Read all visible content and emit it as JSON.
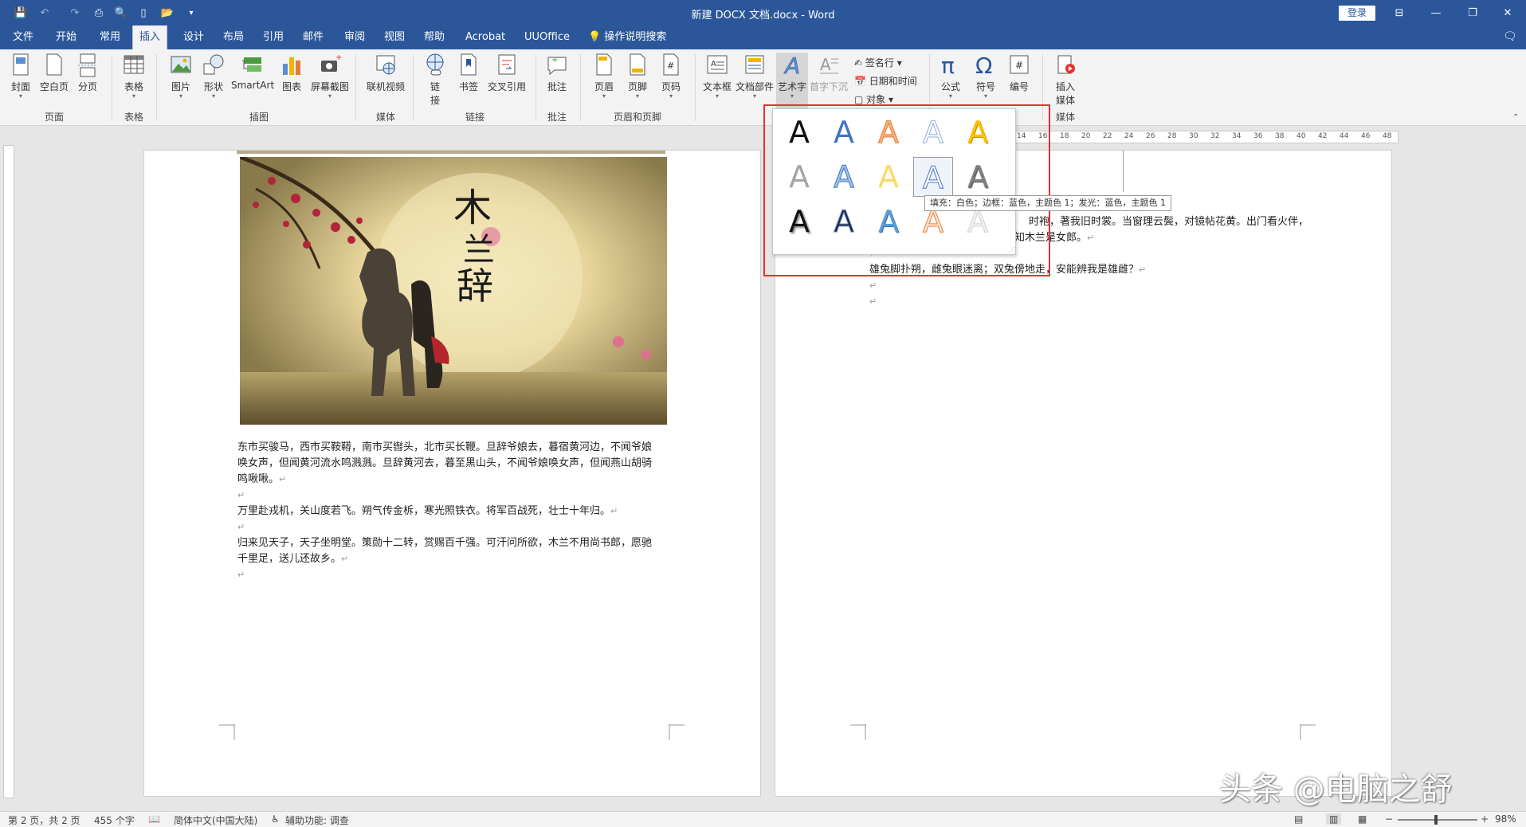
{
  "window": {
    "title": "新建 DOCX 文档.docx  -  Word",
    "login": "登录"
  },
  "tabs": [
    "文件",
    "开始",
    "常用",
    "插入",
    "设计",
    "布局",
    "引用",
    "邮件",
    "审阅",
    "视图",
    "帮助",
    "Acrobat",
    "UUOffice"
  ],
  "active_tab": "插入",
  "tell_me": "操作说明搜索",
  "ribbon": {
    "buttons": {
      "cover": "封面",
      "blank": "空白页",
      "pagebreak": "分页",
      "table": "表格",
      "picture": "图片",
      "shapes": "形状",
      "smartart": "SmartArt",
      "chart": "图表",
      "screenshot": "屏幕截图",
      "online_video": "联机视频",
      "link_1": "链",
      "link_2": "接",
      "bookmark": "书签",
      "crossref": "交叉引用",
      "comment": "批注",
      "header": "页眉",
      "footer": "页脚",
      "pagenum": "页码",
      "textbox": "文本框",
      "quickparts": "文档部件",
      "wordart": "艺术字",
      "dropcap": "首字下沉",
      "signature": "签名行",
      "datetime": "日期和时间",
      "object": "对象",
      "equation": "公式",
      "symbol": "符号",
      "number": "编号",
      "media_1": "插入",
      "media_2": "媒体"
    },
    "groups": {
      "pages": "页面",
      "tables": "表格",
      "illustrations": "插图",
      "media": "媒体",
      "links": "链接",
      "comments": "批注",
      "header_footer": "页眉和页脚",
      "media2": "媒体"
    }
  },
  "ruler_numbers": [
    "14",
    "16",
    "18",
    "20",
    "22",
    "24",
    "26",
    "28",
    "30",
    "32",
    "34",
    "36",
    "38",
    "40",
    "42",
    "44",
    "46",
    "48"
  ],
  "page1": {
    "image_title": "木兰辞",
    "paragraphs": [
      "东市买骏马，西市买鞍鞯，南市买辔头，北市买长鞭。旦辞爷娘去，暮宿黄河边，不闻爷娘",
      "唤女声，但闻黄河流水鸣溅溅。旦辞黄河去，暮至黑山头，不闻爷娘唤女声，但闻燕山胡骑",
      "鸣啾啾。",
      "万里赴戎机，关山度若飞。朔气传金柝，寒光照铁衣。将军百战死，壮士十年归。",
      "归来见天子，天子坐明堂。策勋十二转，赏赐百千强。可汗问所欲，木兰不用尚书郎，愿驰",
      "千里足，送儿还故乡。"
    ]
  },
  "page2": {
    "fragments": [
      "时袍，著我旧时裳。当窗理云鬓，对镜帖花黄。出门看火伴，",
      "知木兰是女郎。",
      "雄兔脚扑朔，雌兔眼迷离；双兔傍地走，安能辨我是雄雌？"
    ]
  },
  "wordart_tooltip": "填充：白色；边框：蓝色，主题色 1；发光：蓝色，主题色 1",
  "statusbar": {
    "page": "第 2 页，共 2 页",
    "words": "455 个字",
    "language": "简体中文(中国大陆)",
    "accessibility": "辅助功能: 调查",
    "zoom": "98%"
  },
  "watermark": "头条 @电脑之舒",
  "colors": {
    "title_bar": "#2b579a",
    "highlight": "#e53030"
  }
}
